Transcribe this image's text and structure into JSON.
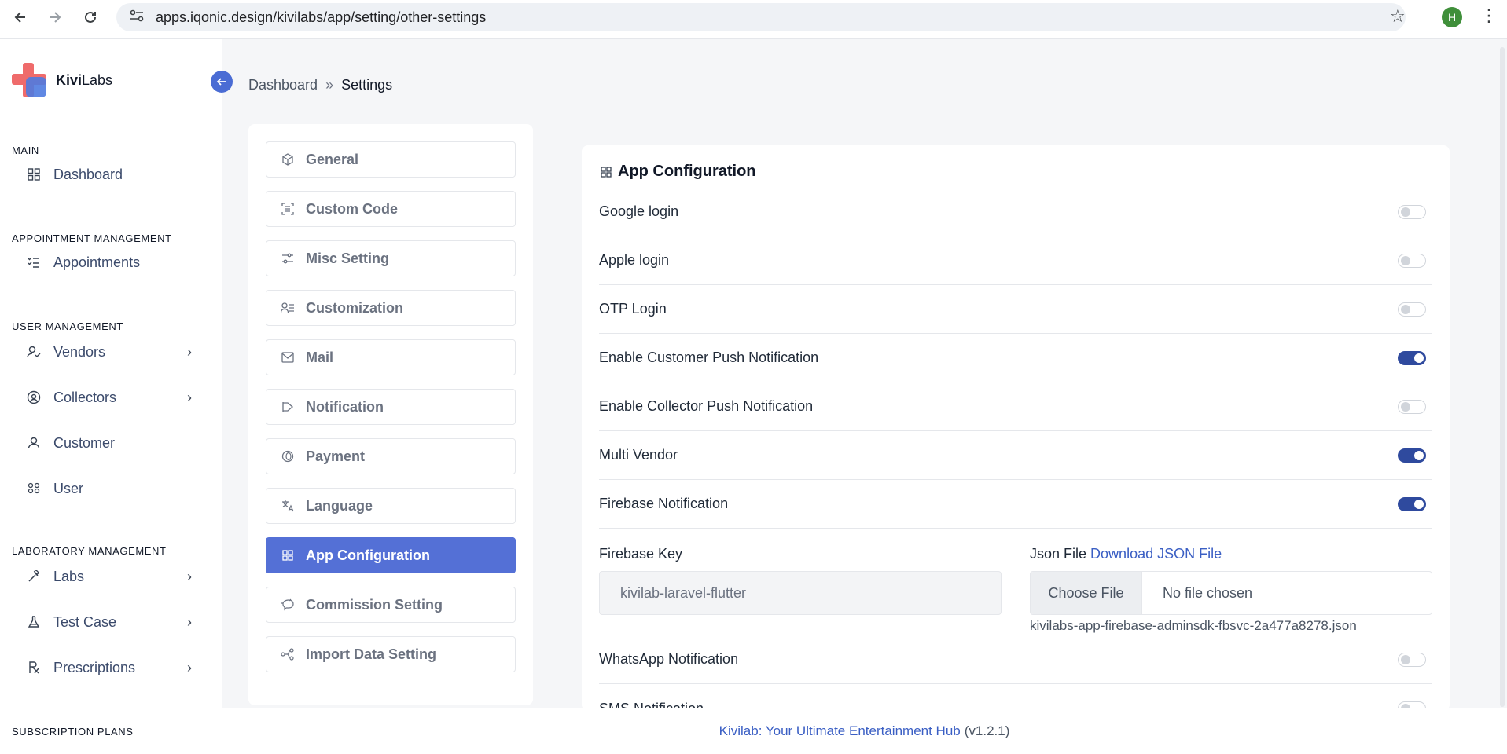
{
  "browser": {
    "url": "apps.iqonic.design/kivilabs/app/setting/other-settings",
    "profile_initial": "H"
  },
  "brand": {
    "name_bold": "Kivi",
    "name_rest": "Labs"
  },
  "sidebar": {
    "sections": {
      "main": "MAIN",
      "appointment": "APPOINTMENT MANAGEMENT",
      "user": "USER MANAGEMENT",
      "laboratory": "LABORATORY MANAGEMENT",
      "subscription": "SUBSCRIPTION PLANS"
    },
    "items": {
      "dashboard": "Dashboard",
      "appointments": "Appointments",
      "vendors": "Vendors",
      "collectors": "Collectors",
      "customer": "Customer",
      "user": "User",
      "labs": "Labs",
      "test_case": "Test Case",
      "prescriptions": "Prescriptions"
    }
  },
  "breadcrumb": {
    "home": "Dashboard",
    "current": "Settings"
  },
  "settings_menu": {
    "general": "General",
    "custom_code": "Custom Code",
    "misc_setting": "Misc Setting",
    "customization": "Customization",
    "mail": "Mail",
    "notification": "Notification",
    "payment": "Payment",
    "language": "Language",
    "app_configuration": "App Configuration",
    "commission_setting": "Commission Setting",
    "import_data_setting": "Import Data Setting"
  },
  "config": {
    "title": "App Configuration",
    "toggles": {
      "google_login": {
        "label": "Google login",
        "on": false
      },
      "apple_login": {
        "label": "Apple login",
        "on": false
      },
      "otp_login": {
        "label": "OTP Login",
        "on": false
      },
      "customer_push": {
        "label": "Enable Customer Push Notification",
        "on": true
      },
      "collector_push": {
        "label": "Enable Collector Push Notification",
        "on": false
      },
      "multi_vendor": {
        "label": "Multi Vendor",
        "on": true
      },
      "firebase_notification": {
        "label": "Firebase Notification",
        "on": true
      },
      "whatsapp_notification": {
        "label": "WhatsApp Notification",
        "on": false
      },
      "sms_notification": {
        "label": "SMS Notification",
        "on": false
      }
    },
    "firebase_key_label": "Firebase Key",
    "firebase_key_value": "kivilab-laravel-flutter",
    "json_file_label": "Json File",
    "json_download_link": "Download JSON File",
    "choose_file_button": "Choose File",
    "file_status": "No file chosen",
    "current_file": "kivilabs-app-firebase-adminsdk-fbsvc-2a477a8278.json"
  },
  "footer": {
    "link_text": "Kivilab: Your Ultimate Entertainment Hub",
    "version": "(v1.2.1)"
  },
  "colors": {
    "accent": "#5470d6",
    "toggle_on": "#2f4a9e",
    "link": "#3b5fc4"
  }
}
